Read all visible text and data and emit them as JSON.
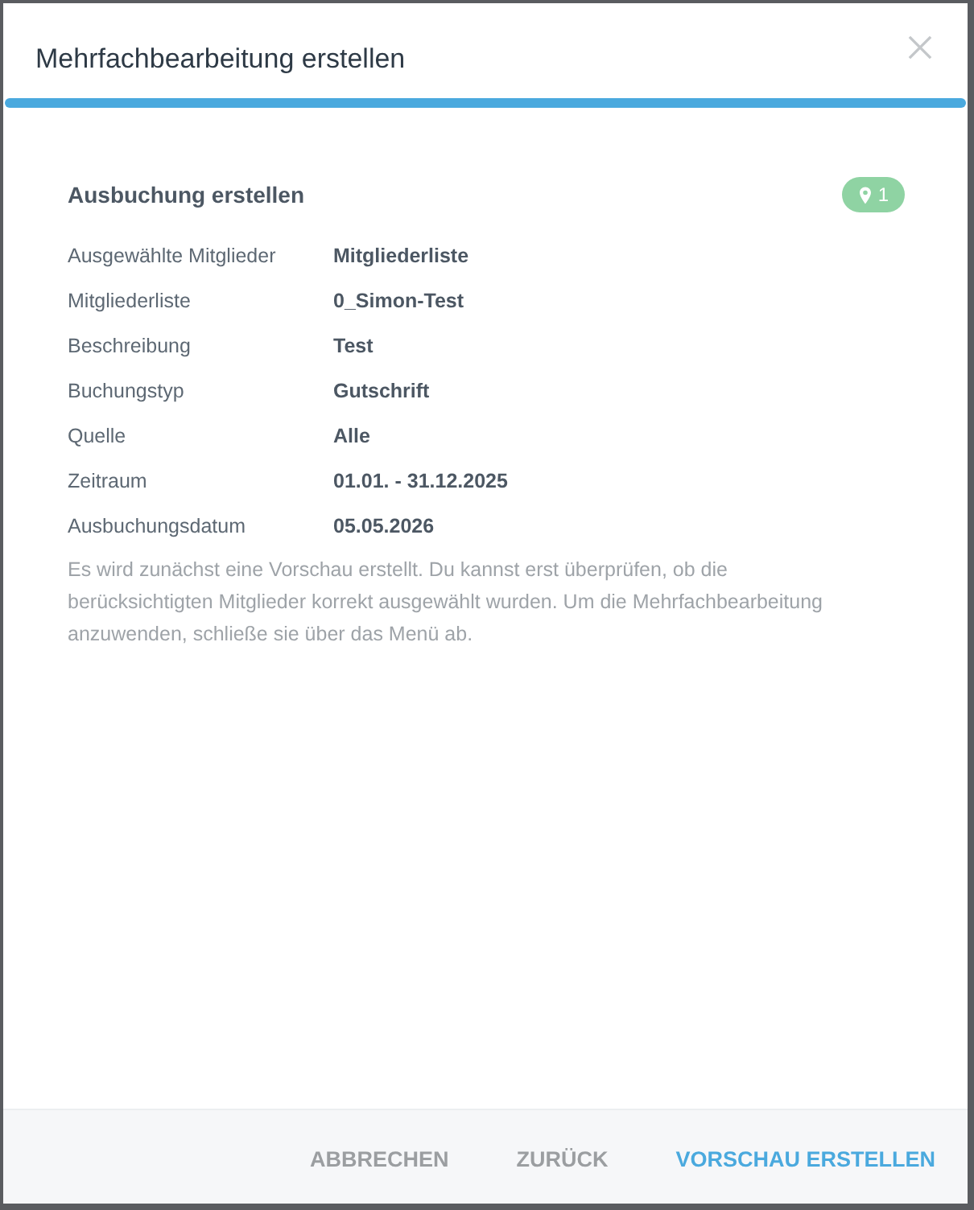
{
  "dialog": {
    "title": "Mehrfachbearbeitung erstellen"
  },
  "section": {
    "title": "Ausbuchung erstellen",
    "badge": {
      "count": "1"
    }
  },
  "details": [
    {
      "label": "Ausgewählte Mitglieder",
      "value": "Mitgliederliste"
    },
    {
      "label": "Mitgliederliste",
      "value": "0_Simon-Test"
    },
    {
      "label": "Beschreibung",
      "value": "Test"
    },
    {
      "label": "Buchungstyp",
      "value": "Gutschrift"
    },
    {
      "label": "Quelle",
      "value": "Alle"
    },
    {
      "label": "Zeitraum",
      "value": "01.01. - 31.12.2025"
    },
    {
      "label": "Ausbuchungsdatum",
      "value": "05.05.2026"
    }
  ],
  "note": "Es wird zunächst eine Vorschau erstellt. Du kannst erst überprüfen, ob die berücksichtigten Mitglieder korrekt ausgewählt wurden. Um die Mehrfachbearbeitung anzuwenden, schließe sie über das Menü ab.",
  "buttons": [
    {
      "label": "ABBRECHEN",
      "kind": "secondary"
    },
    {
      "label": "ZURÜCK",
      "kind": "secondary"
    },
    {
      "label": "VORSCHAU ERSTELLEN",
      "kind": "primary"
    }
  ]
}
